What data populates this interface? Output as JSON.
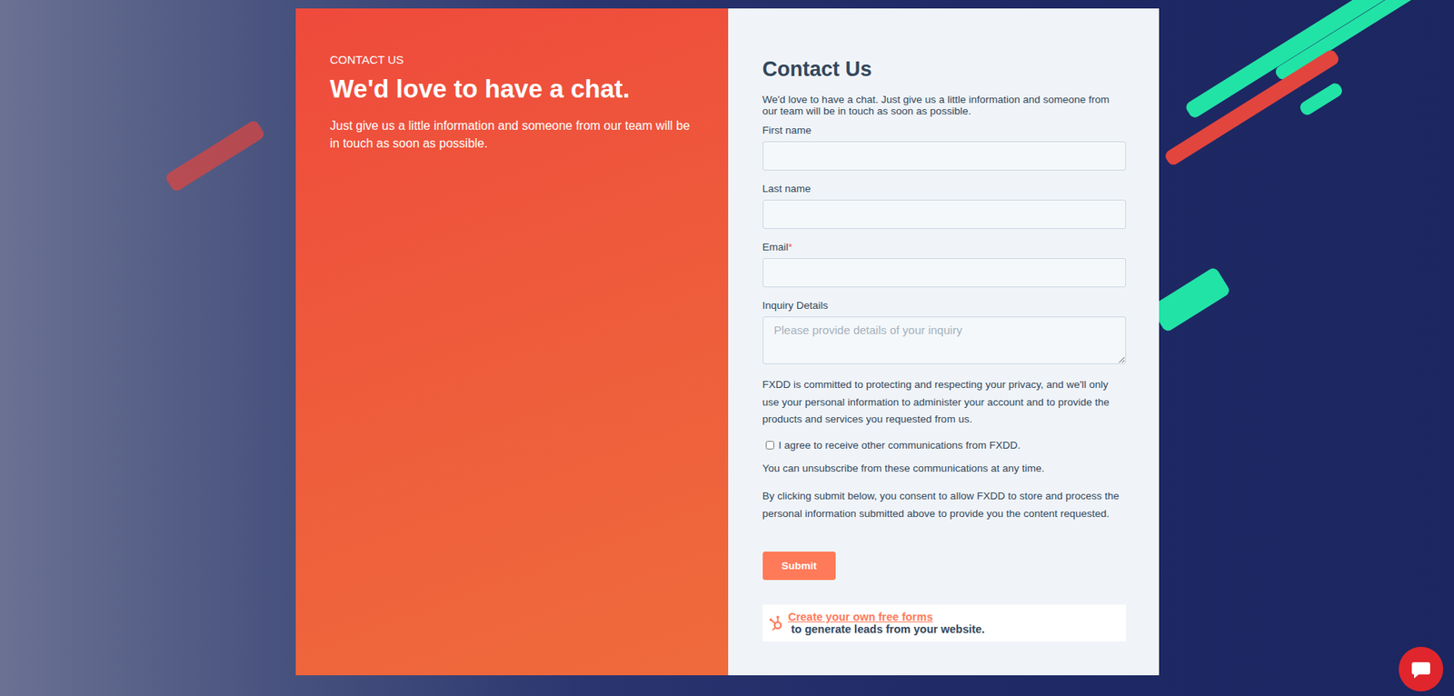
{
  "hero": {
    "eyebrow": "CONTACT US",
    "heading": "We'd love to have a chat.",
    "text": "Just give us a little information and someone from our team will be in touch as soon as possible."
  },
  "form": {
    "title": "Contact Us",
    "intro": "We'd love to have a chat. Just give us a little information and someone from our team will be in touch as soon as possible.",
    "required_mark": "*",
    "fields": [
      {
        "label": "First name",
        "required": false,
        "kind": "input"
      },
      {
        "label": "Last name",
        "required": false,
        "kind": "input"
      },
      {
        "label": "Email",
        "required": true,
        "kind": "input"
      },
      {
        "label": "Inquiry Details",
        "required": false,
        "kind": "textarea",
        "placeholder": "Please provide details of your inquiry"
      }
    ],
    "privacy": "FXDD is committed to protecting and respecting your privacy, and we'll only use your personal information to administer your account and to provide the products and services you requested from us.",
    "consent": {
      "label": "I agree to receive other communications from FXDD.",
      "checked": false
    },
    "unsubscribe": "You can unsubscribe from these communications at any time.",
    "submit_note": "By clicking submit below, you consent to allow FXDD to store and process the personal information submitted above to provide you the content requested.",
    "submit": "Submit"
  },
  "badge": {
    "link": "Create your own free forms",
    "text": " to generate leads from your website."
  }
}
